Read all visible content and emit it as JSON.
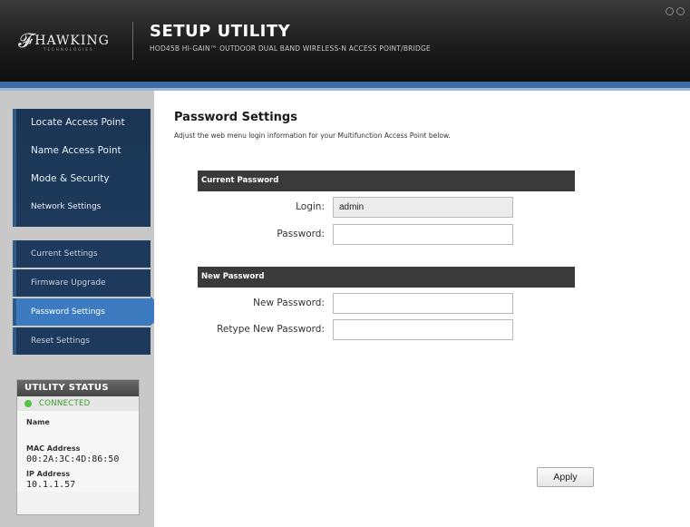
{
  "header": {
    "logo_text": "HAWKING",
    "logo_subtext": "TECHNOLOGIES",
    "title": "SETUP UTILITY",
    "subtitle": "HOD45B HI-GAIN™ OUTDOOR DUAL BAND WIRELESS-N ACCESS POINT/BRIDGE"
  },
  "sidebar": {
    "primary": [
      {
        "label": "Locate Access Point"
      },
      {
        "label": "Name Access Point"
      },
      {
        "label": "Mode & Security"
      },
      {
        "label": "Network Settings"
      }
    ],
    "secondary": [
      {
        "label": "Current Settings"
      },
      {
        "label": "Firmware Upgrade"
      },
      {
        "label": "Password Settings"
      },
      {
        "label": "Reset Settings"
      }
    ]
  },
  "status": {
    "header": "UTILITY STATUS",
    "connection": "CONNECTED",
    "name_label": "Name",
    "name_value": "",
    "mac_label": "MAC Address",
    "mac_value": "00:2A:3C:4D:86:50",
    "ip_label": "IP Address",
    "ip_value": "10.1.1.57"
  },
  "main": {
    "title": "Password Settings",
    "description": "Adjust the web menu login information for your Multifunction Access Point below.",
    "current_section": "Current Password",
    "login_label": "Login:",
    "login_value": "admin",
    "password_label": "Password:",
    "password_value": "",
    "new_section": "New Password",
    "new_password_label": "New Password:",
    "new_password_value": "",
    "retype_label": "Retype New Password:",
    "retype_value": "",
    "apply_label": "Apply"
  },
  "colors": {
    "accent": "#3d7bc0",
    "nav_bg": "#1d3a5c",
    "header_bg": "#1a1a1a",
    "connected": "#4fc93c"
  }
}
